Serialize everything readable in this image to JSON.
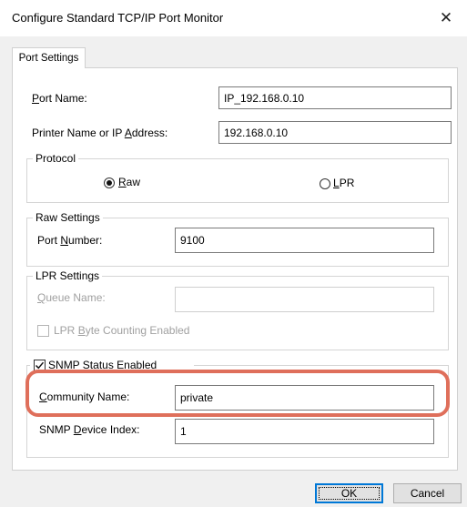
{
  "window": {
    "title": "Configure Standard TCP/IP Port Monitor",
    "close_glyph": "✕"
  },
  "tabs": [
    {
      "label": "Port Settings",
      "selected": true
    }
  ],
  "port_name": {
    "label_u": "P",
    "label_rest": "ort Name:",
    "value": "IP_192.168.0.10"
  },
  "printer_address": {
    "label_pre": "Printer Name or IP ",
    "label_u": "A",
    "label_rest": "ddress:",
    "value": "192.168.0.10"
  },
  "protocol": {
    "legend": "Protocol",
    "raw": {
      "label_u": "R",
      "label_rest": "aw",
      "selected": true
    },
    "lpr": {
      "label_u": "L",
      "label_rest": "PR",
      "selected": false
    }
  },
  "raw_settings": {
    "legend": "Raw Settings",
    "port_number": {
      "label_pre": "Port ",
      "label_u": "N",
      "label_rest": "umber:",
      "value": "9100"
    }
  },
  "lpr_settings": {
    "legend": "LPR Settings",
    "queue_name": {
      "label_u": "Q",
      "label_rest": "ueue Name:",
      "value": ""
    },
    "byte_counting": {
      "label_pre": "LPR ",
      "label_u": "B",
      "label_rest": "yte Counting Enabled",
      "checked": false
    }
  },
  "snmp": {
    "checkbox": {
      "label_pre": "S",
      "label_u": "N",
      "label_rest": "MP Status Enabled",
      "checked": true
    },
    "community": {
      "label_u": "C",
      "label_rest": "ommunity Name:",
      "value": "private"
    },
    "device_index": {
      "label_pre": "SNMP ",
      "label_u": "D",
      "label_rest": "evice Index:",
      "value": "1"
    }
  },
  "buttons": {
    "ok": "OK",
    "cancel": "Cancel"
  },
  "colors": {
    "highlight": "#df6f5b",
    "dialog_bg": "#f0f0f0",
    "focus_border": "#0078d7"
  }
}
